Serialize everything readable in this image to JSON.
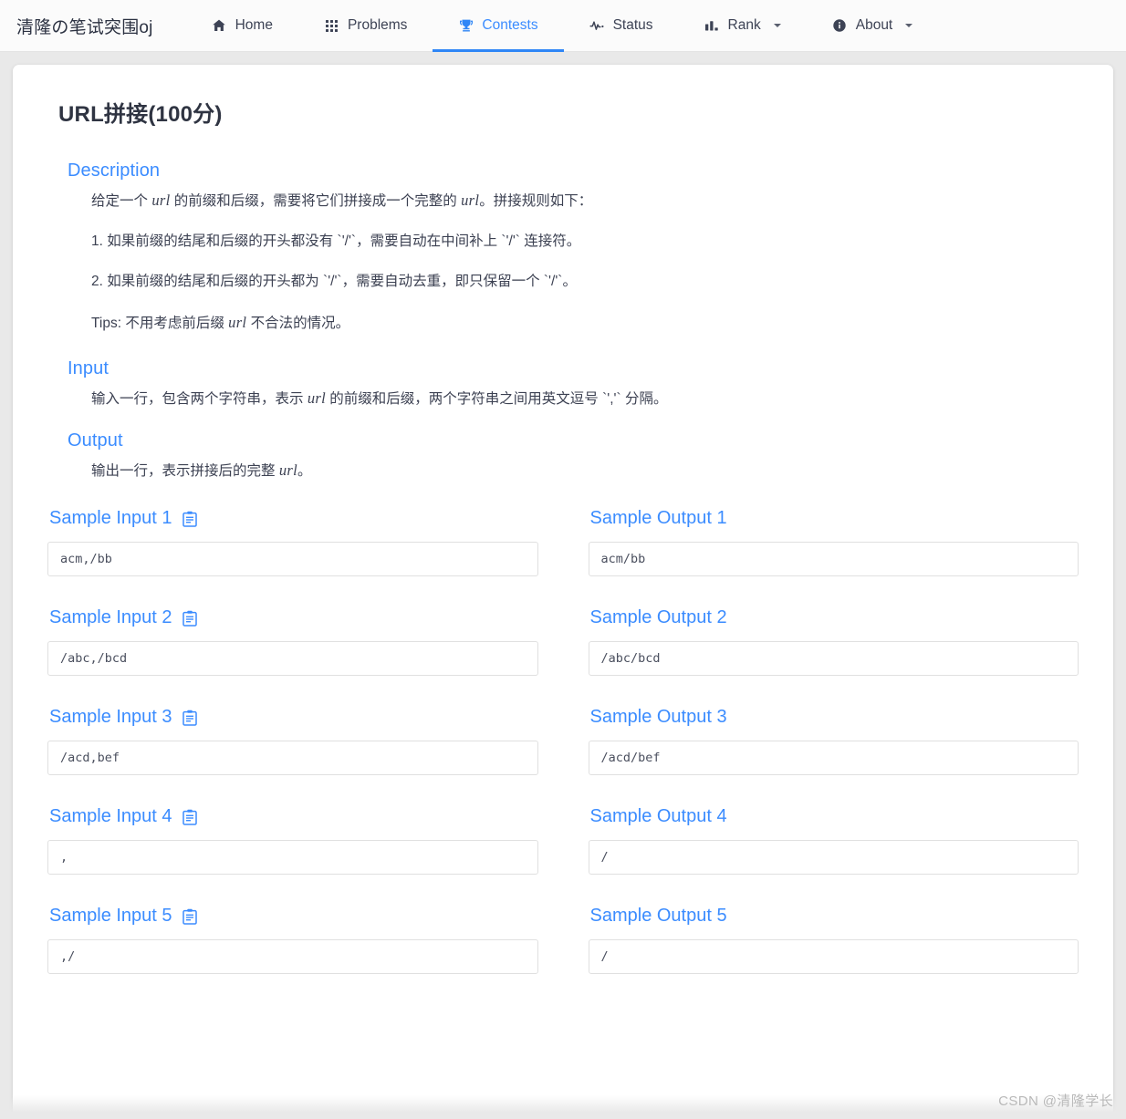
{
  "navbar": {
    "brand": "清隆の笔试突围oj",
    "items": [
      {
        "label": "Home",
        "icon": "home-icon",
        "active": false,
        "caret": false
      },
      {
        "label": "Problems",
        "icon": "grid-icon",
        "active": false,
        "caret": false
      },
      {
        "label": "Contests",
        "icon": "trophy-icon",
        "active": true,
        "caret": false
      },
      {
        "label": "Status",
        "icon": "activity-icon",
        "active": false,
        "caret": false
      },
      {
        "label": "Rank",
        "icon": "barchart-icon",
        "active": false,
        "caret": true
      },
      {
        "label": "About",
        "icon": "info-icon",
        "active": false,
        "caret": true
      }
    ]
  },
  "problem": {
    "title": "URL拼接(100分)",
    "sections": {
      "description": {
        "heading": "Description",
        "intro_a": "给定一个 ",
        "intro_url1": "url",
        "intro_b": " 的前缀和后缀，需要将它们拼接成一个完整的 ",
        "intro_url2": "url",
        "intro_c": "。拼接规则如下：",
        "rule1": "1. 如果前缀的结尾和后缀的开头都没有 `'/'`，需要自动在中间补上 `'/'` 连接符。",
        "rule2": "2. 如果前缀的结尾和后缀的开头都为 `'/'`，需要自动去重，即只保留一个 `'/'`。",
        "tips_a": "Tips: 不用考虑前后缀 ",
        "tips_url": "url",
        "tips_b": " 不合法的情况。"
      },
      "input": {
        "heading": "Input",
        "text_a": "输入一行，包含两个字符串，表示 ",
        "text_url": "url",
        "text_b": " 的前缀和后缀，两个字符串之间用英文逗号 `','` 分隔。"
      },
      "output": {
        "heading": "Output",
        "text_a": "输出一行，表示拼接后的完整 ",
        "text_url": "url",
        "text_b": "。"
      }
    },
    "samples": [
      {
        "input_label": "Sample Input 1",
        "input_value": "acm,/bb",
        "output_label": "Sample Output 1",
        "output_value": "acm/bb"
      },
      {
        "input_label": "Sample Input 2",
        "input_value": "/abc,/bcd",
        "output_label": "Sample Output 2",
        "output_value": "/abc/bcd"
      },
      {
        "input_label": "Sample Input 3",
        "input_value": "/acd,bef",
        "output_label": "Sample Output 3",
        "output_value": "/acd/bef"
      },
      {
        "input_label": "Sample Input 4",
        "input_value": ",",
        "output_label": "Sample Output 4",
        "output_value": "/"
      },
      {
        "input_label": "Sample Input 5",
        "input_value": ",/",
        "output_label": "Sample Output 5",
        "output_value": "/"
      }
    ],
    "copy_icon": "clipboard-copy-icon"
  },
  "watermark": "CSDN @清隆学长",
  "colors": {
    "accent_blue": "#3b8cff",
    "nav_text": "#3d4355",
    "title_text": "#2f3442",
    "page_bg": "#e9e9e9",
    "card_bg": "#ffffff",
    "box_border": "#e0e0e0"
  }
}
